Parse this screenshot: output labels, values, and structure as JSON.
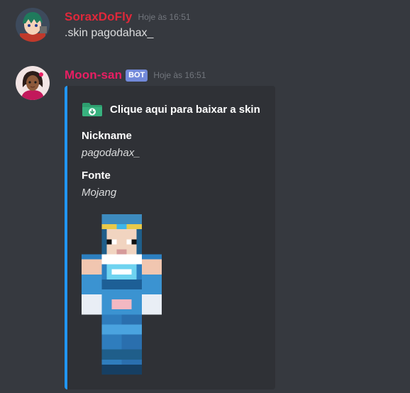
{
  "messages": [
    {
      "username": "SoraxDoFly",
      "username_color": "#e0283a",
      "timestamp": "Hoje às 16:51",
      "content": ".skin pagodahax_",
      "avatar": "anime-avatar-green-hair"
    },
    {
      "username": "Moon-san",
      "username_color": "#e91e63",
      "bot_tag": "BOT",
      "timestamp": "Hoje às 16:51",
      "avatar": "anime-avatar-dark-skin",
      "embed": {
        "accent_color": "#2196f3",
        "author_icon": "green-download-folder-icon",
        "author_name": "Clique aqui para baixar a skin",
        "fields": [
          {
            "name": "Nickname",
            "value": "pagodahax_"
          },
          {
            "name": "Fonte",
            "value": "Mojang"
          }
        ],
        "image": "minecraft-skin-blue-sailor-outfit"
      }
    }
  ],
  "colors": {
    "background": "#36393f",
    "embed_background": "#2f3136",
    "bot_tag": "#7289da",
    "timestamp": "#72767d"
  }
}
